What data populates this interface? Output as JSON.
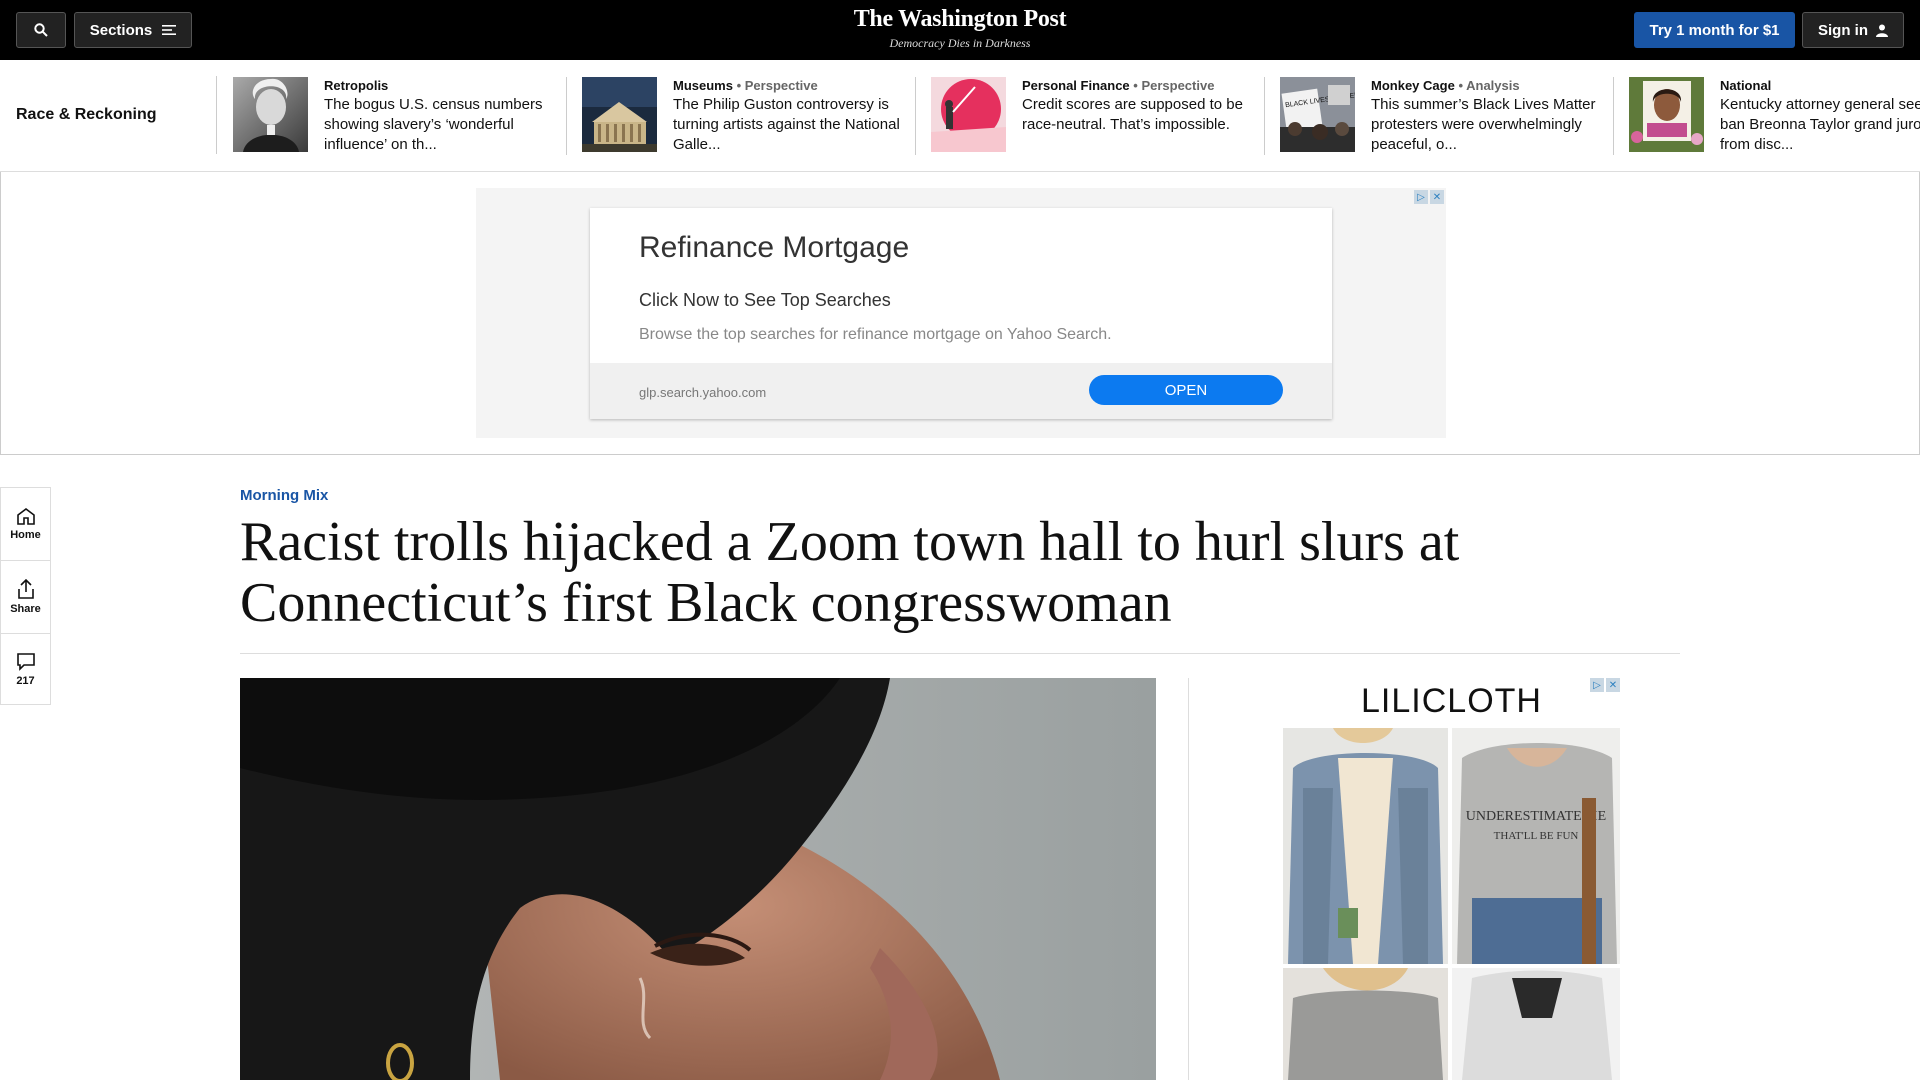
{
  "header": {
    "sections_label": "Sections",
    "masthead": "The Washington Post",
    "tagline": "Democracy Dies in Darkness",
    "try_label": "Try 1 month for $1",
    "signin_label": "Sign in"
  },
  "carousel": {
    "label": "Race & Reckoning",
    "items": [
      {
        "kicker": "Retropolis",
        "sub": "",
        "headline": "The bogus U.S. census numbers showing slavery’s ‘wonderful influence’ on th..."
      },
      {
        "kicker": "Museums",
        "sub": "• Perspective",
        "headline": "The Philip Guston controversy is turning artists against the National Galle..."
      },
      {
        "kicker": "Personal Finance",
        "sub": "• Perspective",
        "headline": "Credit scores are supposed to be race-neutral. That’s impossible."
      },
      {
        "kicker": "Monkey Cage",
        "sub": "• Analysis",
        "headline": "This summer’s Black Lives Matter protesters were overwhelmingly peaceful, o..."
      },
      {
        "kicker": "National",
        "sub": "",
        "headline": "Kentucky attorney general seeks to ban Breonna Taylor grand juror from disc..."
      }
    ],
    "sign_text": "BLACK LIVES MATTER"
  },
  "ad": {
    "title": "Refinance Mortgage",
    "subtitle": "Click Now to See Top Searches",
    "description": "Browse the top searches for refinance mortgage on Yahoo Search.",
    "url": "glp.search.yahoo.com",
    "cta": "OPEN"
  },
  "rail": {
    "home": "Home",
    "share": "Share",
    "comments": "217"
  },
  "article": {
    "kicker": "Morning Mix",
    "headline": "Racist trolls hijacked a Zoom town hall to hurl slurs at Connecticut’s first Black congresswoman"
  },
  "side_ad": {
    "brand": "LILICLOTH",
    "shirt_text_1": "UNDERESTIMATE ME",
    "shirt_text_2": "THAT'LL BE FUN"
  },
  "colors": {
    "accent": "#1955a5",
    "header_bg": "#000000",
    "ad_button": "#0c7af0"
  }
}
